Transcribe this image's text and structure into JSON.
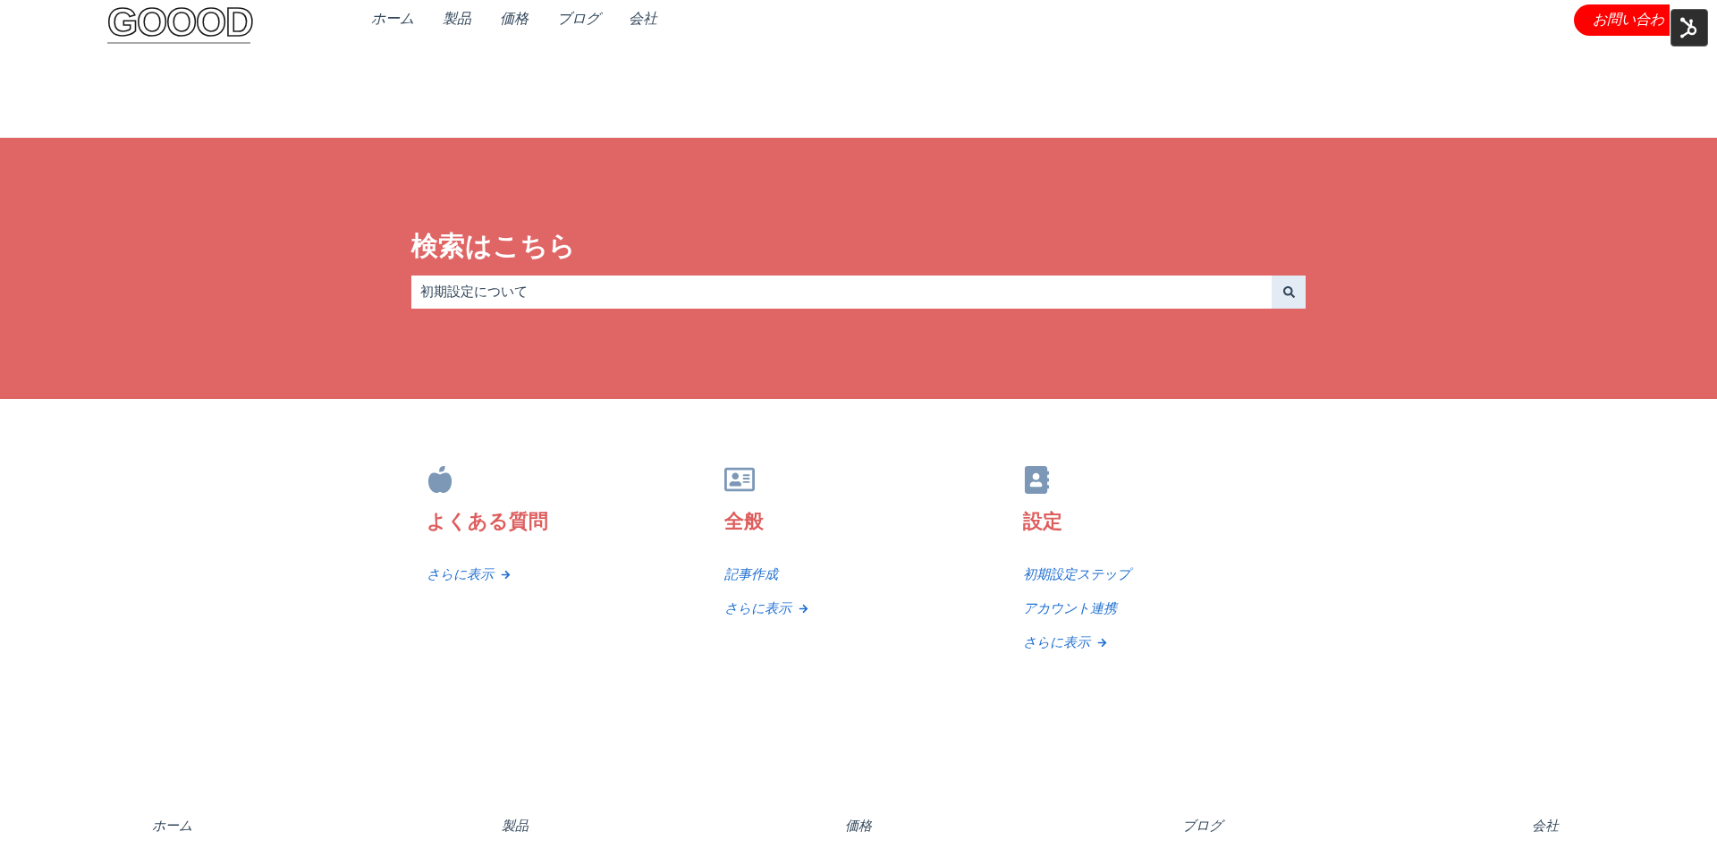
{
  "header": {
    "logo": "GOOOD",
    "nav": [
      "ホーム",
      "製品",
      "価格",
      "ブログ",
      "会社"
    ],
    "contact_button": "お問い合わ"
  },
  "hero": {
    "title": "検索はこちら",
    "search": {
      "value": "初期設定について"
    }
  },
  "categories": [
    {
      "title": "よくある質問",
      "more": "さらに表示"
    },
    {
      "title": "全般",
      "links": [
        "記事作成"
      ],
      "more": "さらに表示"
    },
    {
      "title": "設定",
      "links": [
        "初期設定ステップ",
        "アカウント連携"
      ],
      "more": "さらに表示"
    }
  ],
  "footer": {
    "nav": [
      "ホーム",
      "製品",
      "価格",
      "ブログ",
      "会社"
    ]
  }
}
